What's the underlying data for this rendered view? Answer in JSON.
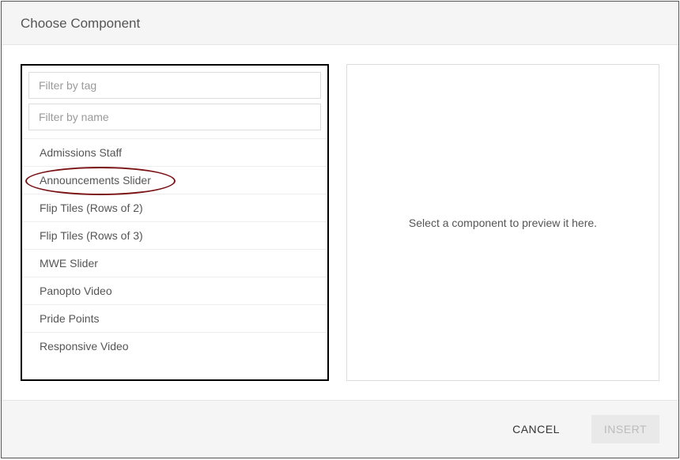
{
  "header": {
    "title": "Choose Component"
  },
  "filters": {
    "tag_placeholder": "Filter by tag",
    "name_placeholder": "Filter by name"
  },
  "components": [
    {
      "label": "Admissions Staff"
    },
    {
      "label": "Announcements Slider"
    },
    {
      "label": "Flip Tiles (Rows of 2)"
    },
    {
      "label": "Flip Tiles (Rows of 3)"
    },
    {
      "label": "MWE Slider"
    },
    {
      "label": "Panopto Video"
    },
    {
      "label": "Pride Points"
    },
    {
      "label": "Responsive Video"
    }
  ],
  "preview": {
    "empty_text": "Select a component to preview it here."
  },
  "footer": {
    "cancel_label": "CANCEL",
    "insert_label": "INSERT"
  }
}
